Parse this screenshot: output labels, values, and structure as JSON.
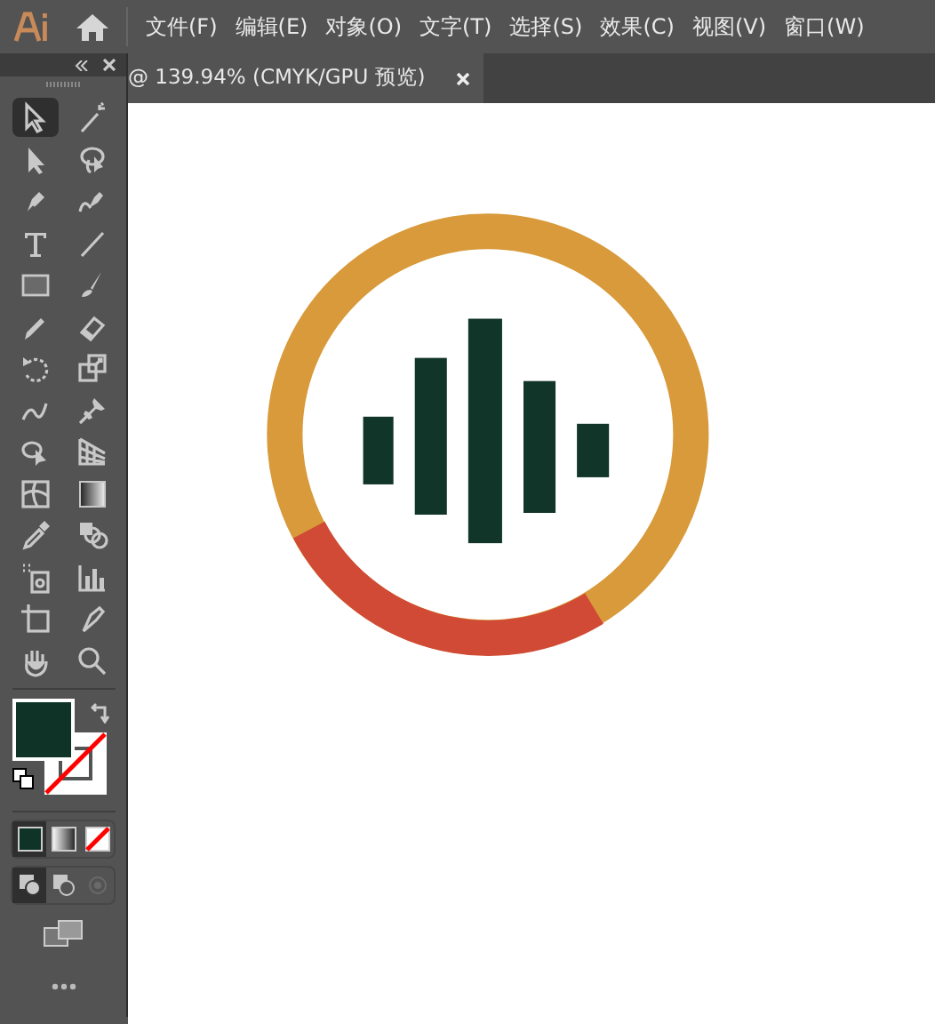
{
  "menu": [
    "文件(F)",
    "编辑(E)",
    "对象(O)",
    "文字(T)",
    "选择(S)",
    "效果(C)",
    "视图(V)",
    "窗口(W)"
  ],
  "document_tab": {
    "title": "@ 139.94% (CMYK/GPU 预览)"
  },
  "tools": [
    {
      "selected": true
    },
    {
      "selected": false
    },
    {
      "selected": false
    },
    {
      "selected": false
    },
    {
      "selected": false
    },
    {
      "selected": false
    },
    {
      "selected": false
    },
    {
      "selected": false
    },
    {
      "selected": false
    },
    {
      "selected": false
    },
    {
      "selected": false
    },
    {
      "selected": false
    },
    {
      "selected": false
    },
    {
      "selected": false
    },
    {
      "selected": false
    },
    {
      "selected": false
    },
    {
      "selected": false
    },
    {
      "selected": false
    },
    {
      "selected": false
    },
    {
      "selected": false
    },
    {
      "selected": false
    },
    {
      "selected": false
    },
    {
      "selected": false
    },
    {
      "selected": false
    },
    {
      "selected": false
    },
    {
      "selected": false
    },
    {
      "selected": false
    },
    {
      "selected": false
    }
  ],
  "fill": {
    "color": "#0f3326"
  },
  "stroke": {
    "none": true
  },
  "color_modes": [
    {
      "selected": true
    },
    {
      "selected": false
    },
    {
      "selected": false
    }
  ],
  "draw_modes": [
    {
      "selected": true,
      "disabled": false
    },
    {
      "selected": false,
      "disabled": false
    },
    {
      "selected": false,
      "disabled": true
    }
  ]
}
